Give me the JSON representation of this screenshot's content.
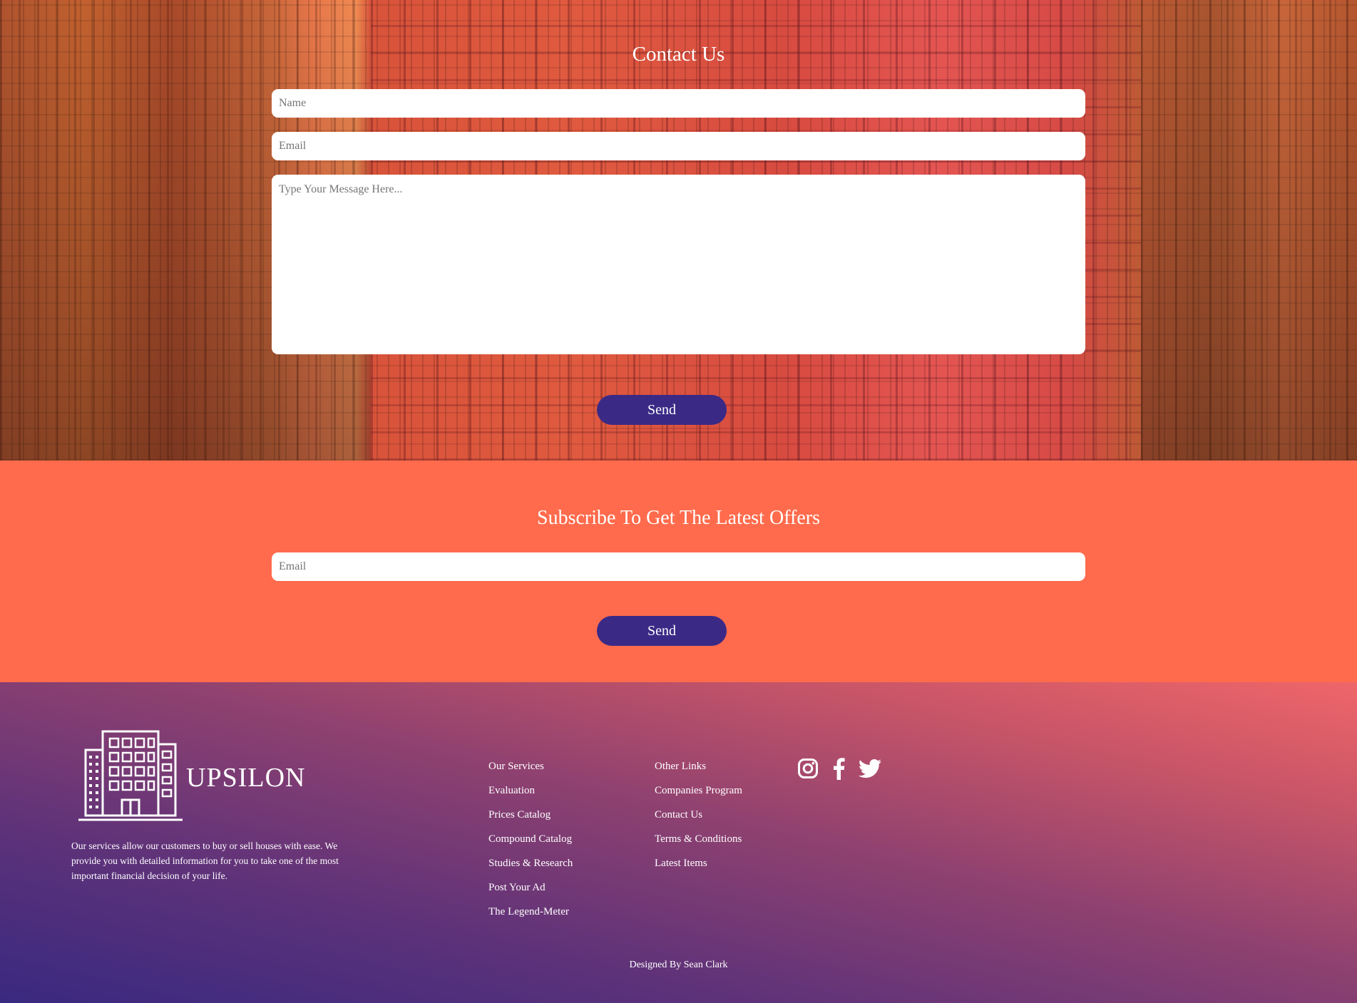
{
  "contact": {
    "title": "Contact Us",
    "name_placeholder": "Name",
    "email_placeholder": "Email",
    "message_placeholder": "Type Your Message Here...",
    "send_label": "Send"
  },
  "subscribe": {
    "title": "Subscribe To Get The Latest Offers",
    "email_placeholder": "Email",
    "send_label": "Send"
  },
  "footer": {
    "brand": "UPSILON",
    "about": "Our services allow our customers to buy or sell houses with ease. We provide you with detailed information for you to take one of the most important financial decision of your life.",
    "links_primary": [
      "Our Services",
      "Evaluation",
      "Prices Catalog",
      "Compound Catalog",
      "Studies & Research",
      "Post Your Ad",
      "The Legend-Meter"
    ],
    "links_secondary": [
      "Other Links",
      "Companies Program",
      "Contact Us",
      "Terms & Conditions",
      "Latest Items"
    ],
    "social_icons": [
      "instagram-icon",
      "facebook-icon",
      "twitter-icon"
    ],
    "credit": "Designed By Sean Clark"
  },
  "colors": {
    "send_button": "#3a2a86",
    "subscribe_bg": "#ff6b4c",
    "footer_gradient_start": "#392980",
    "footer_gradient_end": "#ef6669"
  }
}
